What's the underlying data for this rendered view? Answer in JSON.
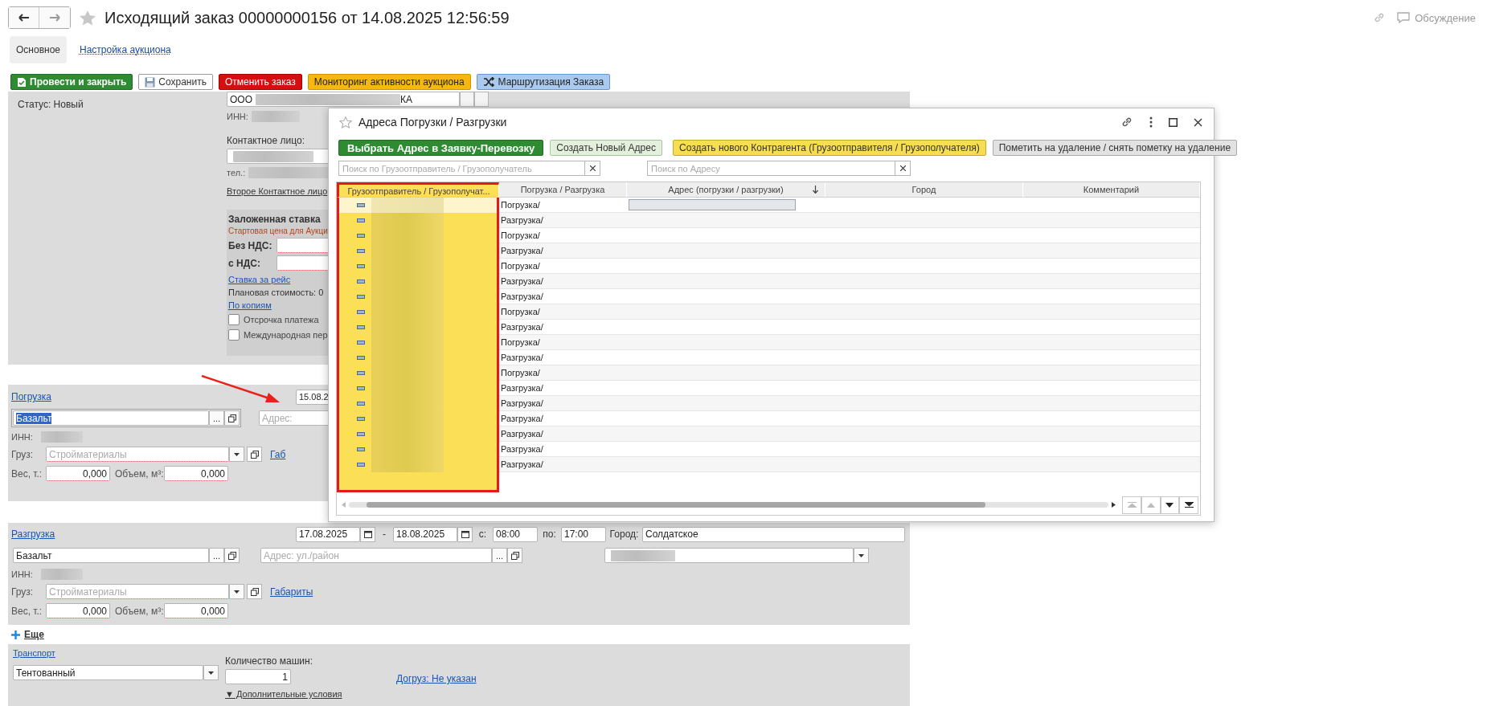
{
  "window": {
    "title": "Исходящий заказ 00000000156 от 14.08.2025 12:56:59",
    "discussion": "Обсуждение"
  },
  "tabs": [
    {
      "label": "Основное",
      "selected": true
    },
    {
      "label": "Настройка аукциона",
      "selected": false
    }
  ],
  "commands": [
    {
      "label": "Провести и закрыть",
      "kind": "post"
    },
    {
      "label": "Сохранить",
      "kind": "save"
    },
    {
      "label": "Отменить заказ",
      "kind": "cancel"
    },
    {
      "label": "Мониторинг активности аукциона",
      "kind": "monitor"
    },
    {
      "label": "Маршрутизация Заказа",
      "kind": "route"
    }
  ],
  "status": "Статус: Новый",
  "counterparty": {
    "value_start": "ООО",
    "value_end": "КА",
    "inn_label": "ИНН:",
    "contact_label": "Контактное лицо:",
    "phone_label": "тел.:",
    "second_contact_link": "Второе Контактное лицо"
  },
  "rate": {
    "title": "Заложенная ставка",
    "subtitle": "Стартовая цена для Аукци",
    "without_vat_label": "Без НДС:",
    "with_vat_label": "с НДС:",
    "per_trip_link": "Ставка за рейс",
    "planned_cost": "Плановая стоимость: 0",
    "copies_link": "По копиям",
    "options": [
      {
        "label": "Отсрочка платежа",
        "checked": false
      },
      {
        "label": "Международная пер",
        "checked": false
      }
    ]
  },
  "loading": {
    "link": "Погрузка",
    "date": "15.08.2",
    "name": "Базальт",
    "focused": true,
    "select_button": "...",
    "address_placeholder": "Адрес:",
    "inn_label": "ИНН:",
    "cargo_label": "Груз:",
    "cargo_placeholder": "Стройматериалы",
    "dimensions_link": "Габ",
    "weight_label": "Вес, т.:",
    "weight": "0,000",
    "volume_label": "Объем, м³:",
    "volume": "0,000"
  },
  "unloading": {
    "link": "Разгрузка",
    "date_from": "17.08.2025",
    "dash": "-",
    "date_to": "18.08.2025",
    "from_label": "с:",
    "time_from": "08:00",
    "to_label": "по:",
    "time_to": "17:00",
    "city_label": "Город:",
    "city": "Солдатское",
    "name": "Базальт",
    "focused": false,
    "select_button": "...",
    "address_placeholder": "Адрес: ул./район",
    "address_select_button": "...",
    "inn_label": "ИНН:",
    "cargo_label": "Груз:",
    "cargo_placeholder": "Стройматериалы",
    "dimensions_link": "Габариты",
    "weight_label": "Вес, т.:",
    "weight": "0,000",
    "volume_label": "Объем, м³:",
    "volume": "0,000"
  },
  "more_link": "Еще",
  "transport": {
    "link": "Транспорт",
    "type": "Тентованный",
    "count_label": "Количество машин:",
    "count": "1",
    "extra_link": "Догруз: Не указан",
    "conditions_link": "▼ Дополнительные условия"
  },
  "dialog": {
    "title": "Адреса Погрузки / Разгрузки",
    "buttons": [
      {
        "label": "Выбрать Адрес в Заявку-Перевозку",
        "kind": "primary"
      },
      {
        "label": "Создать Новый Адрес",
        "kind": "secondary"
      },
      {
        "label": "Создать нового Контрагента (Грузоотправителя / Грузополучателя)",
        "kind": "accent"
      },
      {
        "label": "Пометить на удаление / снять пометку на удаление",
        "kind": "neutral"
      }
    ],
    "search_shipper_placeholder": "Поиск по Грузоотправитель / Грузополучатель",
    "search_address_placeholder": "Поиск по Адресу",
    "columns": [
      {
        "label": "Грузоотправитель / Грузополучат...",
        "highlighted": true,
        "sorted": false
      },
      {
        "label": "Погрузка / Разгрузка",
        "highlighted": false,
        "sorted": false
      },
      {
        "label": "Адрес (погрузки / разгрузки)",
        "highlighted": false,
        "sorted": true
      },
      {
        "label": "Город",
        "highlighted": false,
        "sorted": false
      },
      {
        "label": "Комментарий",
        "highlighted": false,
        "sorted": false
      }
    ],
    "rows": [
      {
        "direction": "Погрузка/",
        "selected": true
      },
      {
        "direction": "Разгрузка/",
        "selected": false
      },
      {
        "direction": "Погрузка/",
        "selected": false
      },
      {
        "direction": "Разгрузка/",
        "selected": false
      },
      {
        "direction": "Погрузка/",
        "selected": false
      },
      {
        "direction": "Разгрузка/",
        "selected": false
      },
      {
        "direction": "Разгрузка/",
        "selected": false
      },
      {
        "direction": "Погрузка/",
        "selected": false
      },
      {
        "direction": "Разгрузка/",
        "selected": false
      },
      {
        "direction": "Погрузка/",
        "selected": false
      },
      {
        "direction": "Разгрузка/",
        "selected": false
      },
      {
        "direction": "Погрузка/",
        "selected": false
      },
      {
        "direction": "Разгрузка/",
        "selected": false
      },
      {
        "direction": "Разгрузка/",
        "selected": false
      },
      {
        "direction": "Разгрузка/",
        "selected": false
      },
      {
        "direction": "Разгрузка/",
        "selected": false
      },
      {
        "direction": "Разгрузка/",
        "selected": false
      },
      {
        "direction": "Разгрузка/",
        "selected": false
      }
    ]
  }
}
